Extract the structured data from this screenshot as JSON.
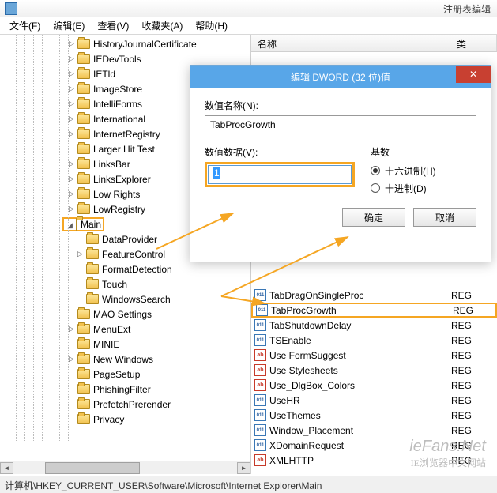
{
  "app": {
    "title": "注册表编辑"
  },
  "menu": {
    "file": "文件(F)",
    "edit": "编辑(E)",
    "view": "查看(V)",
    "fav": "收藏夹(A)",
    "help": "帮助(H)"
  },
  "tree": [
    {
      "label": "HistoryJournalCertificate",
      "expander": "▷",
      "depth": 7
    },
    {
      "label": "IEDevTools",
      "expander": "▷",
      "depth": 7
    },
    {
      "label": "IETld",
      "expander": "▷",
      "depth": 7
    },
    {
      "label": "ImageStore",
      "expander": "▷",
      "depth": 7
    },
    {
      "label": "IntelliForms",
      "expander": "▷",
      "depth": 7
    },
    {
      "label": "International",
      "expander": "▷",
      "depth": 7
    },
    {
      "label": "InternetRegistry",
      "expander": "▷",
      "depth": 7
    },
    {
      "label": "Larger Hit Test",
      "expander": "",
      "depth": 7
    },
    {
      "label": "LinksBar",
      "expander": "▷",
      "depth": 7
    },
    {
      "label": "LinksExplorer",
      "expander": "▷",
      "depth": 7
    },
    {
      "label": "Low Rights",
      "expander": "▷",
      "depth": 7
    },
    {
      "label": "LowRegistry",
      "expander": "▷",
      "depth": 7
    },
    {
      "label": "Main",
      "expander": "◢",
      "depth": 7,
      "highlight": true
    },
    {
      "label": "DataProvider",
      "expander": "",
      "depth": 8
    },
    {
      "label": "FeatureControl",
      "expander": "▷",
      "depth": 8
    },
    {
      "label": "FormatDetection",
      "expander": "",
      "depth": 8
    },
    {
      "label": "Touch",
      "expander": "",
      "depth": 8
    },
    {
      "label": "WindowsSearch",
      "expander": "",
      "depth": 8
    },
    {
      "label": "MAO Settings",
      "expander": "",
      "depth": 7
    },
    {
      "label": "MenuExt",
      "expander": "▷",
      "depth": 7
    },
    {
      "label": "MINIE",
      "expander": "",
      "depth": 7
    },
    {
      "label": "New Windows",
      "expander": "▷",
      "depth": 7
    },
    {
      "label": "PageSetup",
      "expander": "",
      "depth": 7
    },
    {
      "label": "PhishingFilter",
      "expander": "",
      "depth": 7
    },
    {
      "label": "PrefetchPrerender",
      "expander": "",
      "depth": 7
    },
    {
      "label": "Privacy",
      "expander": "",
      "depth": 7
    }
  ],
  "list": {
    "header": {
      "name": "名称",
      "type": "类"
    },
    "rows": [
      {
        "icon": "dword",
        "label": "TabDragOnSingleProc",
        "type": "REG"
      },
      {
        "icon": "dword",
        "label": "TabProcGrowth",
        "type": "REG",
        "highlight": true
      },
      {
        "icon": "dword",
        "label": "TabShutdownDelay",
        "type": "REG"
      },
      {
        "icon": "dword",
        "label": "TSEnable",
        "type": "REG"
      },
      {
        "icon": "str",
        "label": "Use FormSuggest",
        "type": "REG"
      },
      {
        "icon": "str",
        "label": "Use Stylesheets",
        "type": "REG"
      },
      {
        "icon": "str",
        "label": "Use_DlgBox_Colors",
        "type": "REG"
      },
      {
        "icon": "dword",
        "label": "UseHR",
        "type": "REG"
      },
      {
        "icon": "dword",
        "label": "UseThemes",
        "type": "REG"
      },
      {
        "icon": "dword",
        "label": "Window_Placement",
        "type": "REG"
      },
      {
        "icon": "dword",
        "label": "XDomainRequest",
        "type": "REG"
      },
      {
        "icon": "str",
        "label": "XMLHTTP",
        "type": "REG"
      }
    ]
  },
  "dialog": {
    "title": "编辑 DWORD (32 位)值",
    "name_label": "数值名称(N):",
    "name_value": "TabProcGrowth",
    "data_label": "数值数据(V):",
    "data_value": "1",
    "base_label": "基数",
    "hex": "十六进制(H)",
    "dec": "十进制(D)",
    "ok": "确定",
    "cancel": "取消"
  },
  "status": "计算机\\HKEY_CURRENT_USER\\Software\\Microsoft\\Internet Explorer\\Main",
  "watermark": {
    "big": "ieFans.Net",
    "small": "IE浏览器中文网站"
  }
}
